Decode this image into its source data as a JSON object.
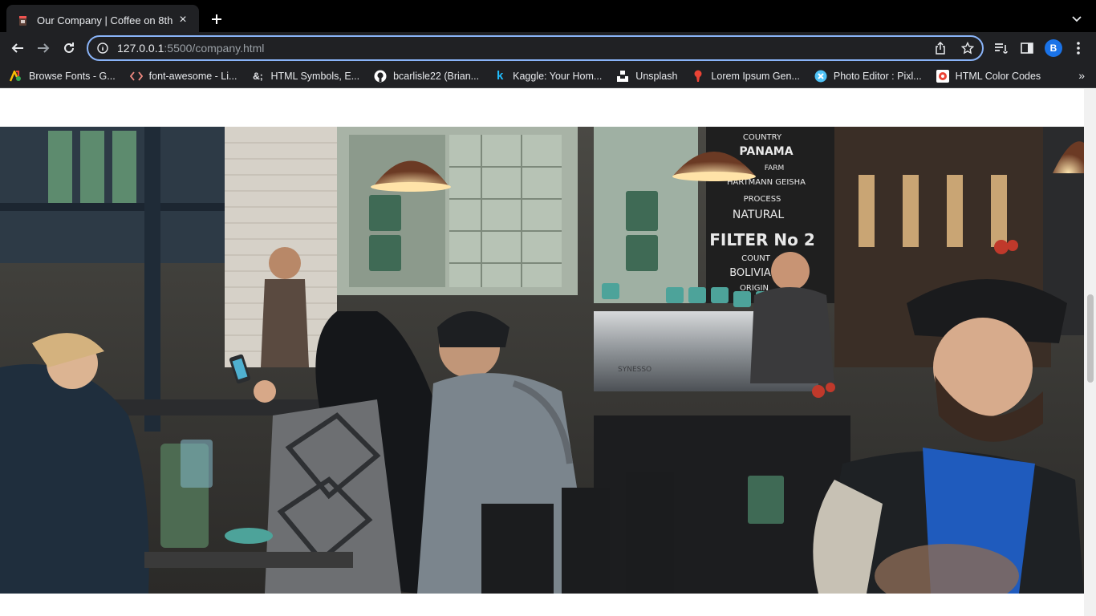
{
  "browser": {
    "tab": {
      "title": "Our Company | Coffee on 8th",
      "close_icon": "×",
      "favicon": "coffee-cup-icon"
    },
    "new_tab_icon": "+",
    "url": {
      "host": "127.0.0.1",
      "path": ":5500/company.html"
    },
    "profile_initial": "B",
    "bookmarks": [
      {
        "label": "Browse Fonts - G...",
        "icon": "google-fonts-icon",
        "color": "#ea4335"
      },
      {
        "label": "font-awesome - Li...",
        "icon": "code-icon",
        "color": "#f28b82"
      },
      {
        "label": "HTML Symbols, E...",
        "icon": "ampersand-icon",
        "color": "#e8eaed"
      },
      {
        "label": "bcarlisle22 (Brian...",
        "icon": "github-icon",
        "color": "#ffffff"
      },
      {
        "label": "Kaggle: Your Hom...",
        "icon": "kaggle-icon",
        "color": "#20beff"
      },
      {
        "label": "Unsplash",
        "icon": "unsplash-icon",
        "color": "#ffffff"
      },
      {
        "label": "Lorem Ipsum Gen...",
        "icon": "lorem-icon",
        "color": "#ea4335"
      },
      {
        "label": "Photo Editor : Pixl...",
        "icon": "pixlr-icon",
        "color": "#4fc3f7"
      },
      {
        "label": "HTML Color Codes",
        "icon": "color-codes-icon",
        "color": "#ea4335"
      }
    ],
    "bookmarks_overflow": "»"
  },
  "page": {
    "hero_image": {
      "description_icon": "coffee-shop-photo",
      "menu_board": [
        "COUNTRY",
        "PANAMA",
        "FARM",
        "HARTMANN GEISHA",
        "PROCESS",
        "NATURAL",
        "FILTER No 2",
        "COUNT",
        "BOLIVIA",
        "ORIGIN"
      ],
      "machine_brand": "SYNESSO"
    }
  }
}
